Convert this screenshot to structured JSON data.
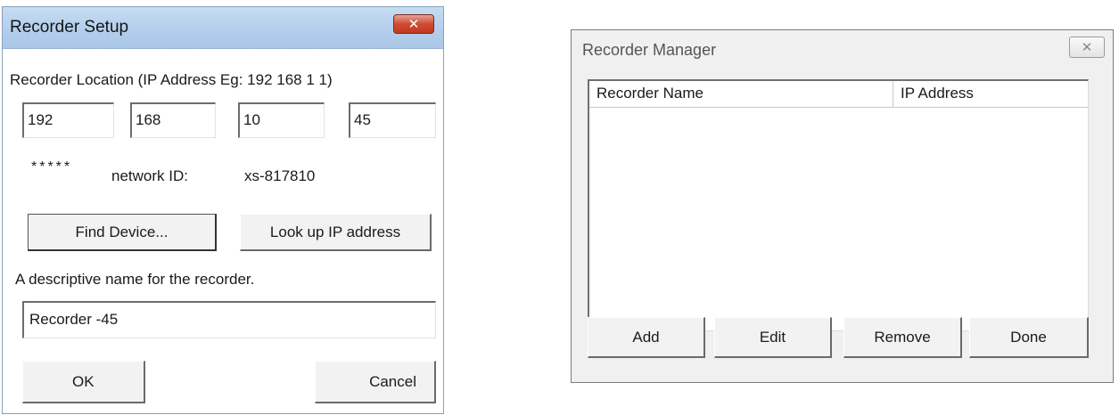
{
  "setup": {
    "title": "Recorder Setup",
    "close_glyph": "✕",
    "location_label": "Recorder Location (IP Address Eg: 192 168 1 1)",
    "ip_octets": [
      "192",
      "168",
      "10",
      "45"
    ],
    "stars": "*****",
    "network_id_label": "network ID:",
    "network_id_value": "xs-817810",
    "find_device_label": "Find Device...",
    "lookup_ip_label": "Look up IP address",
    "name_label": "A descriptive name for the recorder.",
    "name_value": "Recorder -45",
    "ok_label": "OK",
    "cancel_label": "Cancel",
    "colors": {
      "titlebar": "#b4cfec",
      "close": "#cf4b32"
    }
  },
  "manager": {
    "title": "Recorder Manager",
    "close_glyph": "✕",
    "columns": [
      "Recorder Name",
      "IP Address"
    ],
    "rows": [],
    "buttons": {
      "add": "Add",
      "edit": "Edit",
      "remove": "Remove",
      "done": "Done"
    }
  }
}
